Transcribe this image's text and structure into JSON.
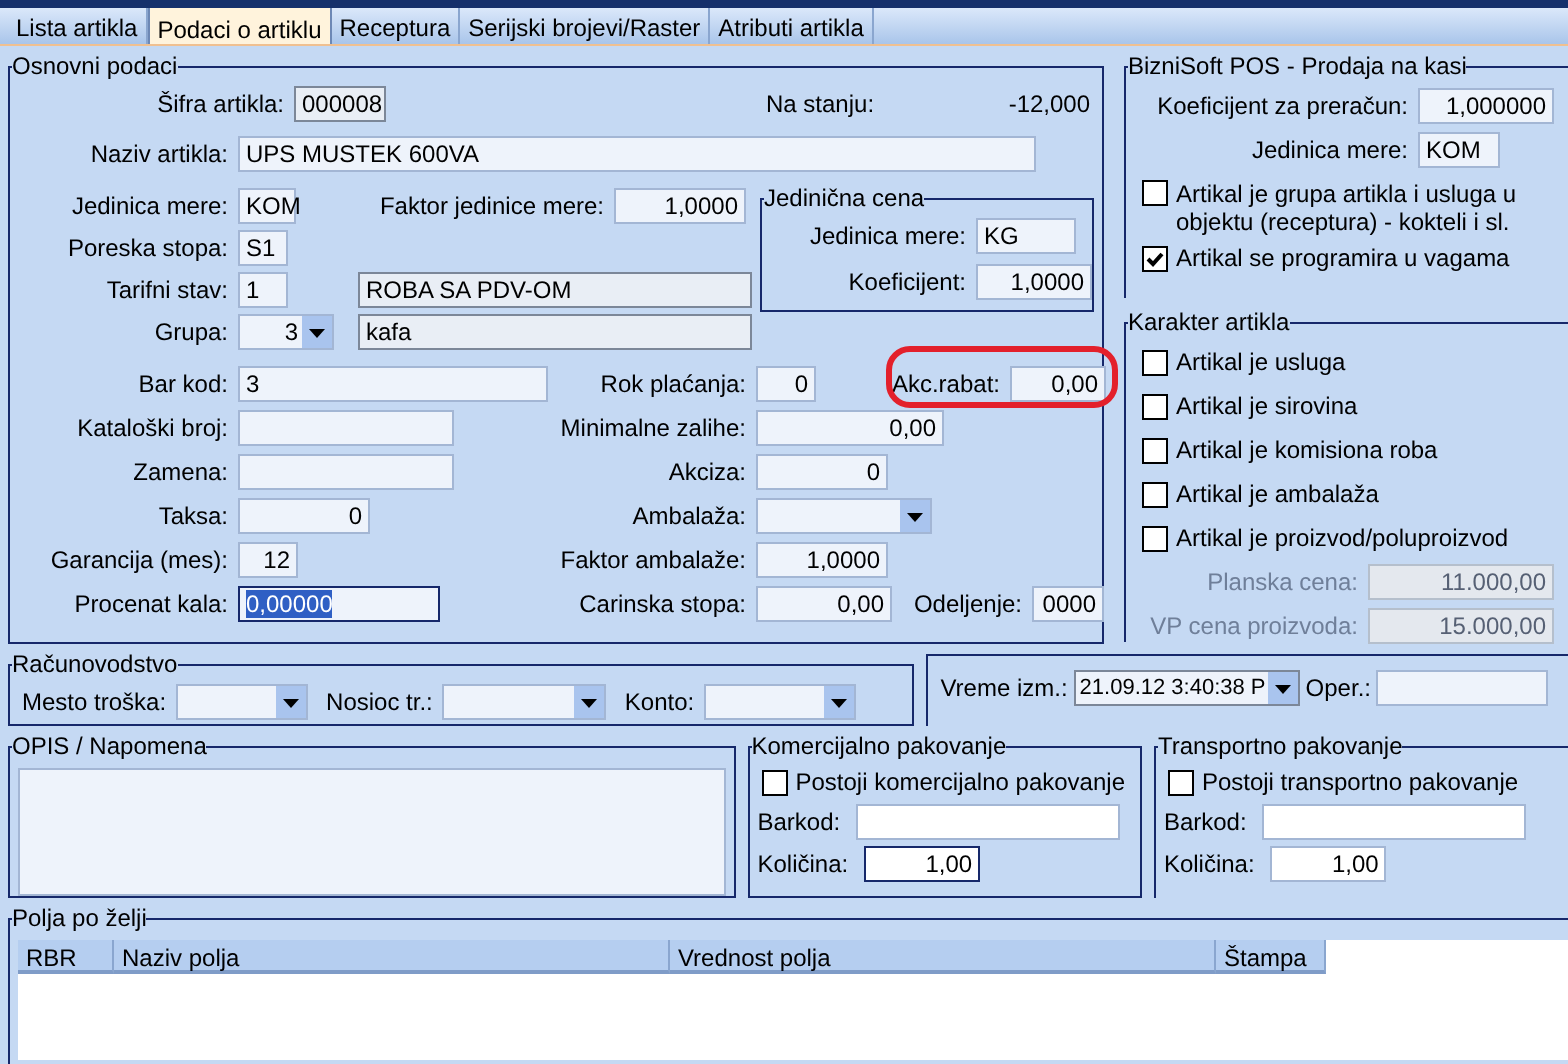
{
  "tabs": [
    {
      "label": "Lista artikla",
      "selected": false
    },
    {
      "label": "Podaci o artiklu",
      "selected": true
    },
    {
      "label": "Receptura",
      "selected": false
    },
    {
      "label": "Serijski brojevi/Raster",
      "selected": false
    },
    {
      "label": "Atributi artikla",
      "selected": false
    }
  ],
  "basic": {
    "title": "Osnovni podaci",
    "code": {
      "label": "Šifra artikla:",
      "value": "000008"
    },
    "stock": {
      "label": "Na stanju:",
      "value": "-12,000"
    },
    "name": {
      "label": "Naziv artikla:",
      "value": "UPS MUSTEK 600VA"
    },
    "unit": {
      "label": "Jedinica mere:",
      "value": "KOM"
    },
    "unit_factor": {
      "label": "Faktor jedinice mere:",
      "value": "1,0000"
    },
    "tax_rate": {
      "label": "Poreska stopa:",
      "value": "S1"
    },
    "tariff": {
      "label": "Tarifni stav:",
      "value": "1",
      "description": "ROBA SA PDV-OM"
    },
    "group": {
      "label": "Grupa:",
      "value": "3",
      "description": "kafa"
    },
    "unit_price": {
      "title": "Jedinična cena",
      "fields": [
        {
          "label": "Jedinica mere:",
          "value": "KG",
          "kind": "text"
        },
        {
          "label": "Koeficijent:",
          "value": "1,0000",
          "kind": "number"
        }
      ]
    },
    "left_fields": [
      {
        "label": "Bar kod:",
        "value": "3",
        "kind": "text"
      },
      {
        "label": "Kataloški broj:",
        "kind": "text"
      },
      {
        "label": "Zamena:",
        "kind": "text"
      },
      {
        "label": "Taksa:",
        "value": "0",
        "kind": "number"
      },
      {
        "label": "Garancija (mes):",
        "value": "12",
        "kind": "number"
      },
      {
        "label": "Procenat kala:",
        "value": "0,00000",
        "kind": "active"
      }
    ],
    "right_fields": [
      {
        "label": "Rok plaćanja:",
        "value": "0",
        "kind": "number",
        "extra": {
          "label": "Akc.rabat:",
          "value": "0,00",
          "highlighted": true
        }
      },
      {
        "label": "Minimalne zalihe:",
        "value": "0,00",
        "kind": "number"
      },
      {
        "label": "Akciza:",
        "value": "0",
        "kind": "number"
      },
      {
        "label": "Ambalaža:",
        "kind": "select"
      },
      {
        "label": "Faktor ambalaže:",
        "value": "1,0000",
        "kind": "number"
      },
      {
        "label": "Carinska stopa:",
        "value": "0,00",
        "kind": "number",
        "extra": {
          "label": "Odeljenje:",
          "value": "0000",
          "highlighted": false
        }
      }
    ]
  },
  "pos": {
    "title": "BizniSoft POS - Prodaja na kasi",
    "coefficient": {
      "label": "Koeficijent za preračun:",
      "value": "1,000000"
    },
    "unit": {
      "label": "Jedinica mere:",
      "value": "KOM"
    },
    "checks": [
      {
        "label": "Artikal je grupa artikla i usluga u objektu (receptura) - kokteli i sl.",
        "checked": false
      },
      {
        "label": "Artikal se programira u vagama",
        "checked": true
      }
    ]
  },
  "character": {
    "title": "Karakter artikla",
    "checks": [
      {
        "label": "Artikal je usluga",
        "checked": false
      },
      {
        "label": "Artikal je sirovina",
        "checked": false
      },
      {
        "label": "Artikal je komisiona roba",
        "checked": false
      },
      {
        "label": "Artikal je ambalaža",
        "checked": false
      },
      {
        "label": "Artikal je proizvod/poluproizvod",
        "checked": false
      }
    ],
    "fields": [
      {
        "label": "Planska cena:",
        "value": "11.000,00",
        "disabled": true
      },
      {
        "label": "VP cena proizvoda:",
        "value": "15.000,00",
        "disabled": true
      }
    ]
  },
  "accounting": {
    "title": "Računovodstvo",
    "dropdowns": [
      {
        "label": "Mesto troška:"
      },
      {
        "label": "Nosioc tr.:"
      },
      {
        "label": "Konto:"
      }
    ]
  },
  "change": {
    "time": {
      "label": "Vreme izm.:",
      "value": "21.09.12 3:40:38 P"
    },
    "operator": {
      "label": "Oper.:"
    }
  },
  "note": {
    "title": "OPIS / Napomena"
  },
  "packaging": [
    {
      "title": "Komercijalno pakovanje",
      "check": {
        "label": "Postoji komercijalno pakovanje",
        "checked": false
      },
      "barcode": {
        "label": "Barkod:"
      },
      "quantity": {
        "label": "Količina:",
        "value": "1,00",
        "focused": true
      }
    },
    {
      "title": "Transportno pakovanje",
      "check": {
        "label": "Postoji transportno pakovanje",
        "checked": false
      },
      "barcode": {
        "label": "Barkod:"
      },
      "quantity": {
        "label": "Količina:",
        "value": "1,00",
        "focused": false
      }
    }
  ],
  "custom_fields": {
    "title": "Polja po želji",
    "columns": [
      "RBR",
      "Naziv polja",
      "Vrednost polja",
      "Štampa"
    ]
  }
}
